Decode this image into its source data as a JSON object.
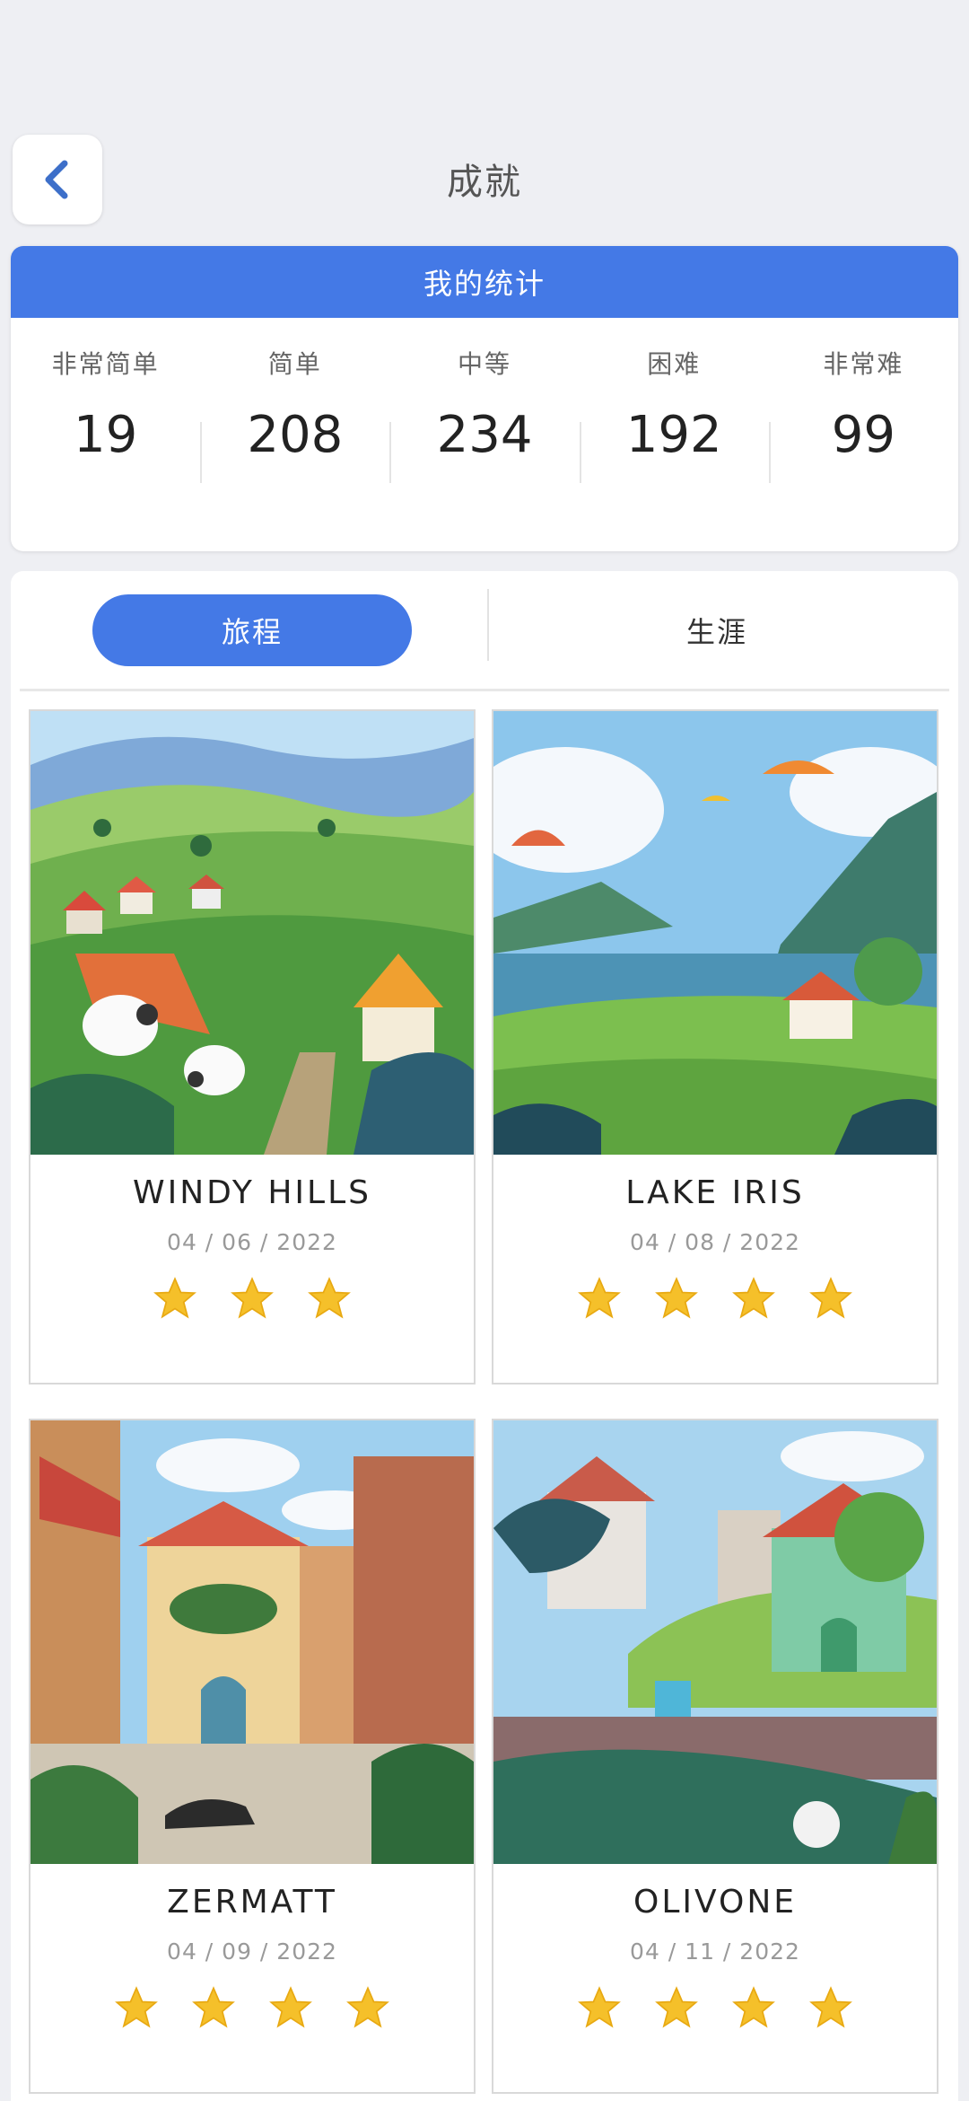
{
  "header": {
    "title": "成就"
  },
  "stats": {
    "title": "我的统计",
    "items": [
      {
        "label": "非常简单",
        "value": "19"
      },
      {
        "label": "简单",
        "value": "208"
      },
      {
        "label": "中等",
        "value": "234"
      },
      {
        "label": "困难",
        "value": "192"
      },
      {
        "label": "非常难",
        "value": "99"
      }
    ]
  },
  "tabs": {
    "active": "旅程",
    "inactive": "生涯"
  },
  "cards": [
    {
      "name": "WINDY HILLS",
      "date": "04 / 06 / 2022",
      "stars": 3
    },
    {
      "name": "LAKE IRIS",
      "date": "04 / 08 / 2022",
      "stars": 4
    },
    {
      "name": "ZERMATT",
      "date": "04 / 09 / 2022",
      "stars": 4
    },
    {
      "name": "OLIVONE",
      "date": "04 / 11 / 2022",
      "stars": 4
    }
  ],
  "colors": {
    "accent": "#4479e6",
    "star": "#f5c02a",
    "background": "#eeeff3"
  }
}
